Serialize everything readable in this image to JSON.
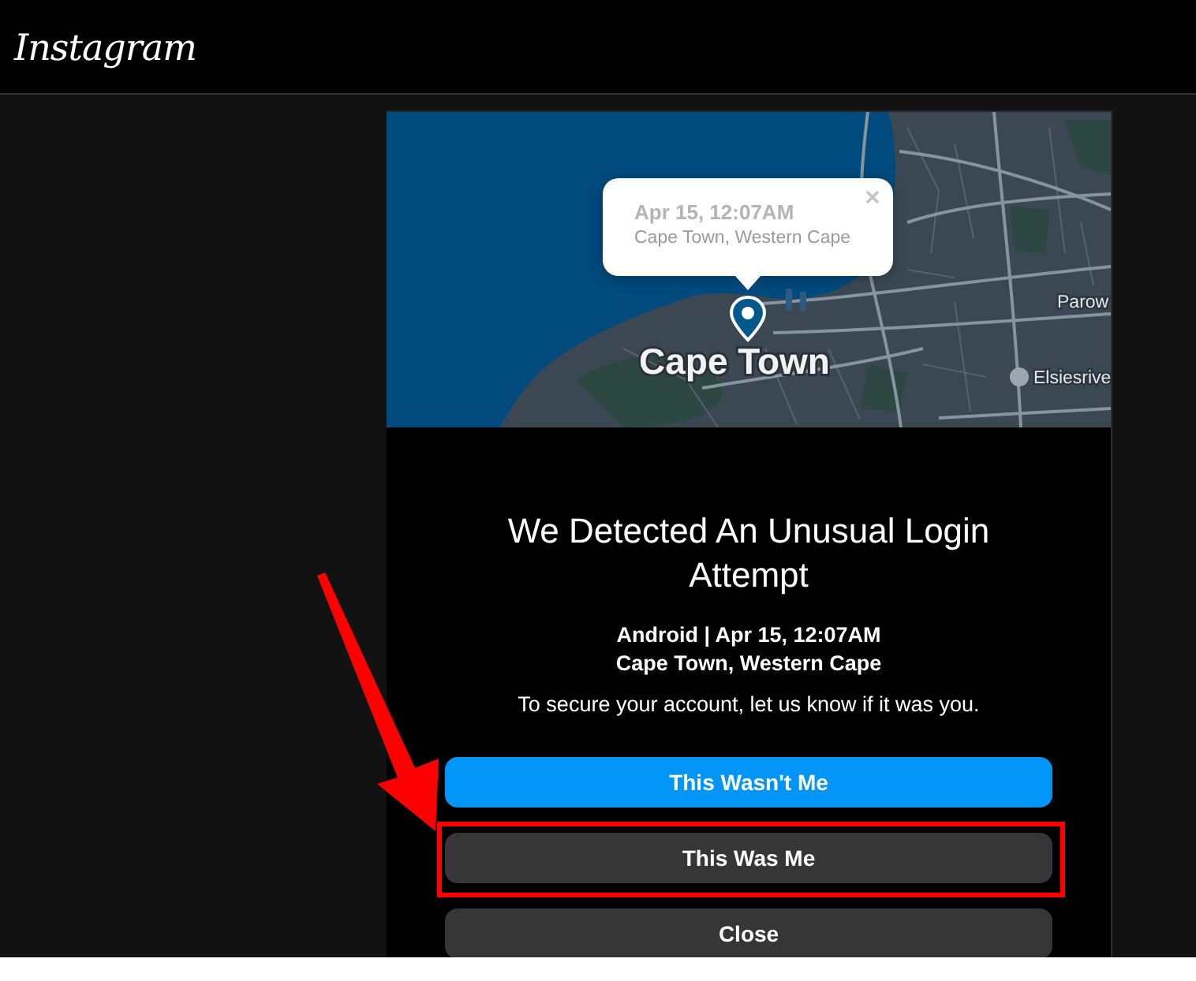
{
  "header": {
    "logo": "Instagram"
  },
  "map": {
    "labels": [
      {
        "text": "Cape Town",
        "kind": "city"
      },
      {
        "text": "Parow",
        "kind": "suburb"
      },
      {
        "text": "Elsiesrive",
        "kind": "suburb"
      }
    ],
    "popup": {
      "title": "Apr 15, 12:07AM",
      "location": "Cape Town, Western Cape"
    }
  },
  "alert": {
    "title": "We Detected An Unusual Login Attempt",
    "device_line": "Android | Apr 15, 12:07AM",
    "location_line": "Cape Town, Western Cape",
    "message": "To secure your account, let us know if it was you."
  },
  "buttons": [
    {
      "label": "This Wasn't Me",
      "kind": "primary",
      "highlighted": false
    },
    {
      "label": "This Was Me",
      "kind": "secondary",
      "highlighted": true
    },
    {
      "label": "Close",
      "kind": "secondary",
      "highlighted": false
    }
  ]
}
